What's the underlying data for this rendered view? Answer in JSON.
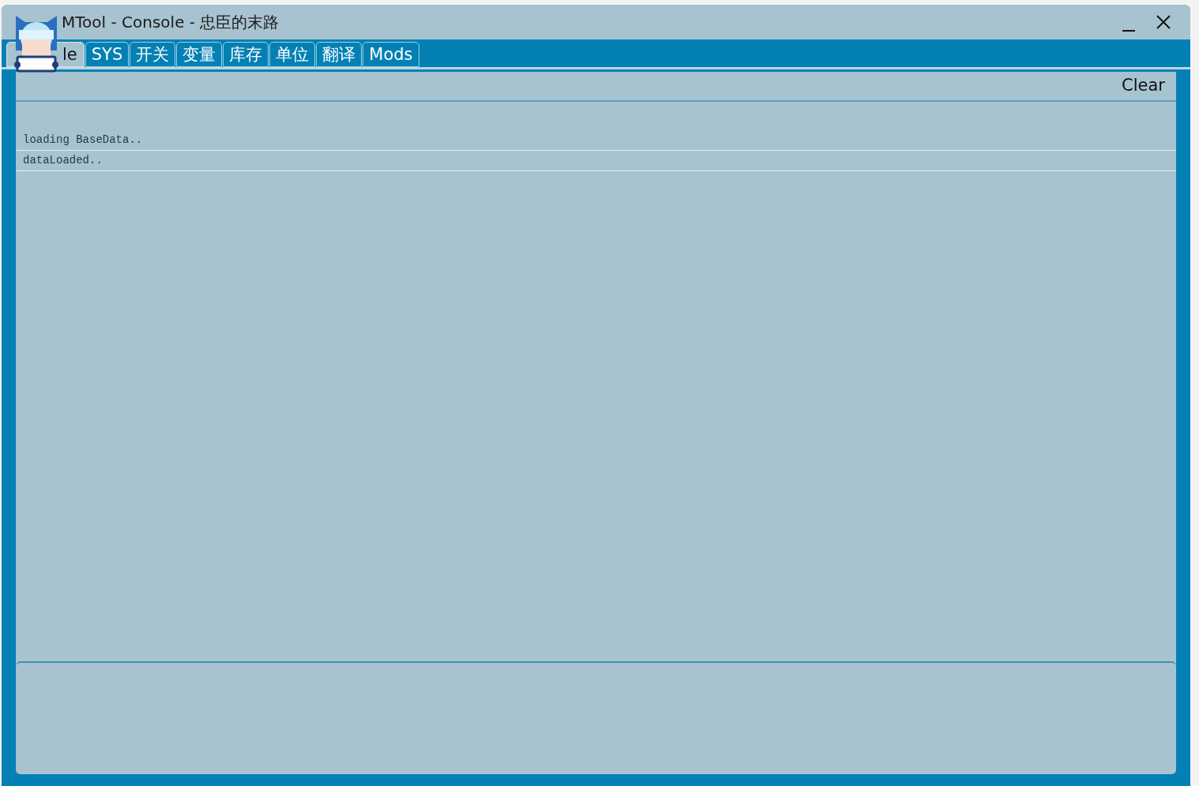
{
  "window": {
    "title": "MTool - Console - 忠臣的末路"
  },
  "tabs": [
    {
      "label": "le",
      "selected": true
    },
    {
      "label": "SYS",
      "selected": false
    },
    {
      "label": "开关",
      "selected": false
    },
    {
      "label": "变量",
      "selected": false
    },
    {
      "label": "库存",
      "selected": false
    },
    {
      "label": "单位",
      "selected": false
    },
    {
      "label": "翻译",
      "selected": false
    },
    {
      "label": "Mods",
      "selected": false
    }
  ],
  "toolbar": {
    "clear_button": "Clear"
  },
  "log_lines": [
    "loading BaseData..",
    "dataLoaded.."
  ]
}
